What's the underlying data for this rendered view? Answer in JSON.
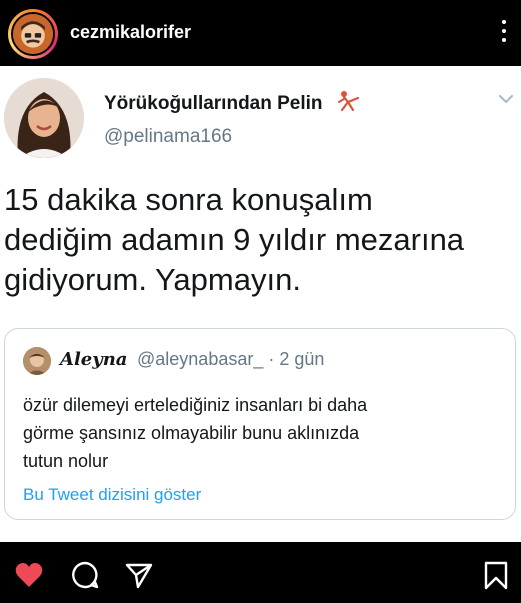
{
  "instagram": {
    "username": "cezmikalorifer",
    "icons": [
      "avatar",
      "more-icon",
      "heart-icon",
      "comment-icon",
      "share-icon",
      "bookmark-icon"
    ],
    "like_color": "#ed4956"
  },
  "tweet": {
    "display_name": "Yörükoğullarından Pelin",
    "handle": "@pelinama166",
    "text_lines": [
      "15 dakika sonra konuşalım",
      "dediğim adamın 9 yıldır mezarına",
      "gidiyorum. Yapmayın."
    ],
    "quote": {
      "display_name": "Aleyna",
      "meta": "@aleynabasar_ · 2 gün",
      "text_lines": [
        "özür dilemeyi ertelediğiniz insanları bi daha",
        "görme şansınız olmayabilir bunu aklınızda",
        "tutun nolur"
      ],
      "thread_link": "Bu Tweet dizisini göster"
    },
    "link_color": "#1da1f2"
  }
}
